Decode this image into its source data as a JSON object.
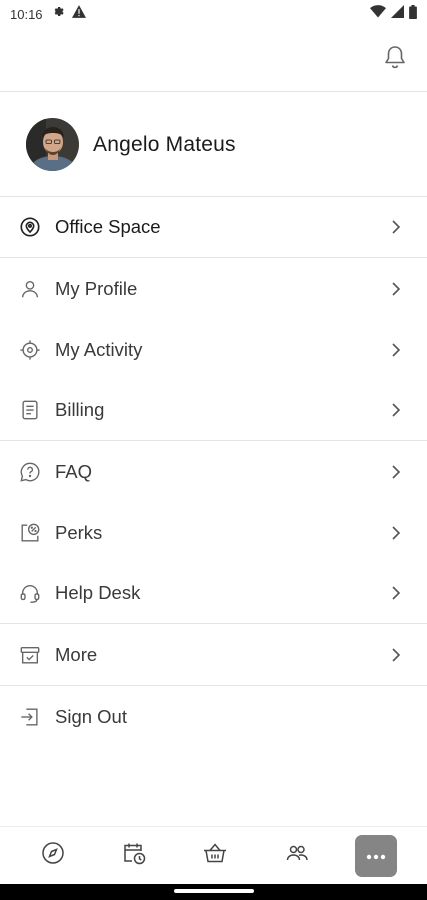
{
  "status_bar": {
    "time": "10:16",
    "icons": [
      "gear-icon",
      "warning-icon",
      "wifi-icon",
      "signal-icon",
      "battery-icon"
    ]
  },
  "header": {
    "notification_icon": "bell-icon"
  },
  "profile": {
    "name": "Angelo Mateus",
    "avatar": "user-photo"
  },
  "menu": {
    "items": [
      {
        "label": "Office Space",
        "icon": "location-pin-icon"
      },
      {
        "label": "My Profile",
        "icon": "person-icon"
      },
      {
        "label": "My Activity",
        "icon": "crosshair-icon"
      },
      {
        "label": "Billing",
        "icon": "document-icon"
      },
      {
        "label": "FAQ",
        "icon": "question-bubble-icon"
      },
      {
        "label": "Perks",
        "icon": "discount-tag-icon"
      },
      {
        "label": "Help Desk",
        "icon": "headset-icon"
      },
      {
        "label": "More",
        "icon": "box-check-icon"
      },
      {
        "label": "Sign Out",
        "icon": "sign-out-icon"
      }
    ]
  },
  "bottom_nav": {
    "items": [
      "compass-icon",
      "calendar-clock-icon",
      "basket-icon",
      "people-icon",
      "more-dots-icon"
    ],
    "selected": "more-dots-icon"
  },
  "colors": {
    "divider": "#e4e4e4",
    "icon_gray": "#555555",
    "selected_tab_bg": "#858585",
    "text_dark": "#1b1b1b"
  }
}
